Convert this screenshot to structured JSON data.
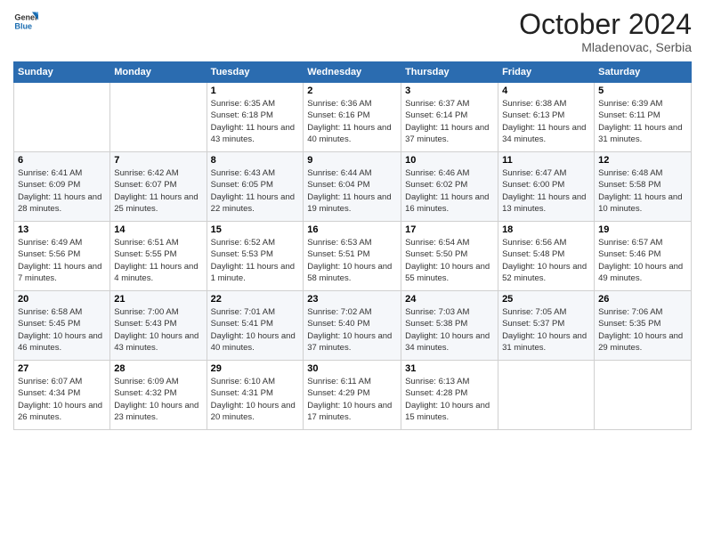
{
  "header": {
    "logo": {
      "general": "General",
      "blue": "Blue"
    },
    "title": "October 2024",
    "location": "Mladenovac, Serbia"
  },
  "weekdays": [
    "Sunday",
    "Monday",
    "Tuesday",
    "Wednesday",
    "Thursday",
    "Friday",
    "Saturday"
  ],
  "weeks": [
    [
      null,
      null,
      {
        "day": "1",
        "sunrise": "Sunrise: 6:35 AM",
        "sunset": "Sunset: 6:18 PM",
        "daylight": "Daylight: 11 hours and 43 minutes."
      },
      {
        "day": "2",
        "sunrise": "Sunrise: 6:36 AM",
        "sunset": "Sunset: 6:16 PM",
        "daylight": "Daylight: 11 hours and 40 minutes."
      },
      {
        "day": "3",
        "sunrise": "Sunrise: 6:37 AM",
        "sunset": "Sunset: 6:14 PM",
        "daylight": "Daylight: 11 hours and 37 minutes."
      },
      {
        "day": "4",
        "sunrise": "Sunrise: 6:38 AM",
        "sunset": "Sunset: 6:13 PM",
        "daylight": "Daylight: 11 hours and 34 minutes."
      },
      {
        "day": "5",
        "sunrise": "Sunrise: 6:39 AM",
        "sunset": "Sunset: 6:11 PM",
        "daylight": "Daylight: 11 hours and 31 minutes."
      }
    ],
    [
      {
        "day": "6",
        "sunrise": "Sunrise: 6:41 AM",
        "sunset": "Sunset: 6:09 PM",
        "daylight": "Daylight: 11 hours and 28 minutes."
      },
      {
        "day": "7",
        "sunrise": "Sunrise: 6:42 AM",
        "sunset": "Sunset: 6:07 PM",
        "daylight": "Daylight: 11 hours and 25 minutes."
      },
      {
        "day": "8",
        "sunrise": "Sunrise: 6:43 AM",
        "sunset": "Sunset: 6:05 PM",
        "daylight": "Daylight: 11 hours and 22 minutes."
      },
      {
        "day": "9",
        "sunrise": "Sunrise: 6:44 AM",
        "sunset": "Sunset: 6:04 PM",
        "daylight": "Daylight: 11 hours and 19 minutes."
      },
      {
        "day": "10",
        "sunrise": "Sunrise: 6:46 AM",
        "sunset": "Sunset: 6:02 PM",
        "daylight": "Daylight: 11 hours and 16 minutes."
      },
      {
        "day": "11",
        "sunrise": "Sunrise: 6:47 AM",
        "sunset": "Sunset: 6:00 PM",
        "daylight": "Daylight: 11 hours and 13 minutes."
      },
      {
        "day": "12",
        "sunrise": "Sunrise: 6:48 AM",
        "sunset": "Sunset: 5:58 PM",
        "daylight": "Daylight: 11 hours and 10 minutes."
      }
    ],
    [
      {
        "day": "13",
        "sunrise": "Sunrise: 6:49 AM",
        "sunset": "Sunset: 5:56 PM",
        "daylight": "Daylight: 11 hours and 7 minutes."
      },
      {
        "day": "14",
        "sunrise": "Sunrise: 6:51 AM",
        "sunset": "Sunset: 5:55 PM",
        "daylight": "Daylight: 11 hours and 4 minutes."
      },
      {
        "day": "15",
        "sunrise": "Sunrise: 6:52 AM",
        "sunset": "Sunset: 5:53 PM",
        "daylight": "Daylight: 11 hours and 1 minute."
      },
      {
        "day": "16",
        "sunrise": "Sunrise: 6:53 AM",
        "sunset": "Sunset: 5:51 PM",
        "daylight": "Daylight: 10 hours and 58 minutes."
      },
      {
        "day": "17",
        "sunrise": "Sunrise: 6:54 AM",
        "sunset": "Sunset: 5:50 PM",
        "daylight": "Daylight: 10 hours and 55 minutes."
      },
      {
        "day": "18",
        "sunrise": "Sunrise: 6:56 AM",
        "sunset": "Sunset: 5:48 PM",
        "daylight": "Daylight: 10 hours and 52 minutes."
      },
      {
        "day": "19",
        "sunrise": "Sunrise: 6:57 AM",
        "sunset": "Sunset: 5:46 PM",
        "daylight": "Daylight: 10 hours and 49 minutes."
      }
    ],
    [
      {
        "day": "20",
        "sunrise": "Sunrise: 6:58 AM",
        "sunset": "Sunset: 5:45 PM",
        "daylight": "Daylight: 10 hours and 46 minutes."
      },
      {
        "day": "21",
        "sunrise": "Sunrise: 7:00 AM",
        "sunset": "Sunset: 5:43 PM",
        "daylight": "Daylight: 10 hours and 43 minutes."
      },
      {
        "day": "22",
        "sunrise": "Sunrise: 7:01 AM",
        "sunset": "Sunset: 5:41 PM",
        "daylight": "Daylight: 10 hours and 40 minutes."
      },
      {
        "day": "23",
        "sunrise": "Sunrise: 7:02 AM",
        "sunset": "Sunset: 5:40 PM",
        "daylight": "Daylight: 10 hours and 37 minutes."
      },
      {
        "day": "24",
        "sunrise": "Sunrise: 7:03 AM",
        "sunset": "Sunset: 5:38 PM",
        "daylight": "Daylight: 10 hours and 34 minutes."
      },
      {
        "day": "25",
        "sunrise": "Sunrise: 7:05 AM",
        "sunset": "Sunset: 5:37 PM",
        "daylight": "Daylight: 10 hours and 31 minutes."
      },
      {
        "day": "26",
        "sunrise": "Sunrise: 7:06 AM",
        "sunset": "Sunset: 5:35 PM",
        "daylight": "Daylight: 10 hours and 29 minutes."
      }
    ],
    [
      {
        "day": "27",
        "sunrise": "Sunrise: 6:07 AM",
        "sunset": "Sunset: 4:34 PM",
        "daylight": "Daylight: 10 hours and 26 minutes."
      },
      {
        "day": "28",
        "sunrise": "Sunrise: 6:09 AM",
        "sunset": "Sunset: 4:32 PM",
        "daylight": "Daylight: 10 hours and 23 minutes."
      },
      {
        "day": "29",
        "sunrise": "Sunrise: 6:10 AM",
        "sunset": "Sunset: 4:31 PM",
        "daylight": "Daylight: 10 hours and 20 minutes."
      },
      {
        "day": "30",
        "sunrise": "Sunrise: 6:11 AM",
        "sunset": "Sunset: 4:29 PM",
        "daylight": "Daylight: 10 hours and 17 minutes."
      },
      {
        "day": "31",
        "sunrise": "Sunrise: 6:13 AM",
        "sunset": "Sunset: 4:28 PM",
        "daylight": "Daylight: 10 hours and 15 minutes."
      },
      null,
      null
    ]
  ]
}
